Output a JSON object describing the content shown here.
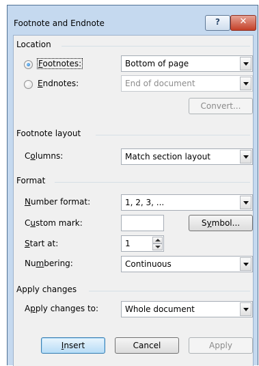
{
  "dialog": {
    "title": "Footnote and Endnote",
    "help_glyph": "?",
    "close_glyph": "✕"
  },
  "location": {
    "group_label": "Location",
    "footnotes": {
      "label_pre": "",
      "label_ul": "F",
      "label_post": "ootnotes:",
      "selected": true,
      "value": "Bottom of page"
    },
    "endnotes": {
      "label_pre": "",
      "label_ul": "E",
      "label_post": "ndnotes:",
      "selected": false,
      "value": "End of document"
    },
    "convert_label": "Convert..."
  },
  "footnote_layout": {
    "group_label": "Footnote layout",
    "columns": {
      "label_pre": "C",
      "label_ul": "o",
      "label_post": "lumns:",
      "value": "Match section layout"
    }
  },
  "format": {
    "group_label": "Format",
    "number_format": {
      "label_pre": "",
      "label_ul": "N",
      "label_post": "umber format:",
      "value": "1, 2, 3, ..."
    },
    "custom_mark": {
      "label_pre": "C",
      "label_ul": "u",
      "label_post": "stom mark:",
      "value": ""
    },
    "symbol_label_pre": "S",
    "symbol_label_ul": "y",
    "symbol_label_post": "mbol...",
    "start_at": {
      "label_pre": "",
      "label_ul": "S",
      "label_post": "tart at:",
      "value": "1"
    },
    "numbering": {
      "label_pre": "Nu",
      "label_ul": "m",
      "label_post": "bering:",
      "value": "Continuous"
    }
  },
  "apply_changes": {
    "group_label": "Apply changes",
    "apply_to": {
      "label_pre": "A",
      "label_ul": "p",
      "label_post": "ply changes to:",
      "value": "Whole document"
    }
  },
  "buttons": {
    "insert_pre": "",
    "insert_ul": "I",
    "insert_post": "nsert",
    "cancel": "Cancel",
    "apply": "Apply"
  }
}
